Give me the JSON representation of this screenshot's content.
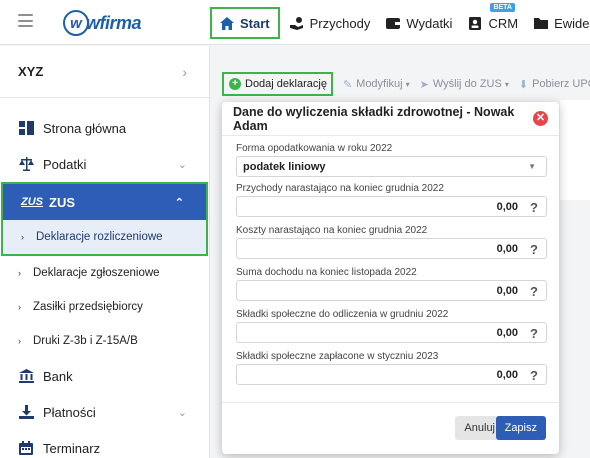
{
  "brand": {
    "logo_text": "wfirma"
  },
  "nav": {
    "items": [
      {
        "label": "Start",
        "icon": "home-icon"
      },
      {
        "label": "Przychody",
        "icon": "hand-coin-icon"
      },
      {
        "label": "Wydatki",
        "icon": "wallet-icon"
      },
      {
        "label": "CRM",
        "icon": "contact-card-icon",
        "badge": "BETA"
      },
      {
        "label": "Ewidencje",
        "icon": "folder-icon"
      }
    ]
  },
  "sidebar": {
    "company": "XYZ",
    "items": [
      {
        "label": "Strona główna",
        "icon": "dashboard-icon"
      },
      {
        "label": "Podatki",
        "icon": "scales-icon"
      },
      {
        "label": "ZUS",
        "icon": "zus-logo-icon",
        "logo_text": "ZUS"
      }
    ],
    "zus_sub": [
      {
        "label": "Deklaracje rozliczeniowe"
      },
      {
        "label": "Deklaracje zgłoszeniowe"
      },
      {
        "label": "Zasiłki przedsiębiorcy"
      },
      {
        "label": "Druki Z-3b i Z-15A/B"
      }
    ],
    "bottom_items": [
      {
        "label": "Bank",
        "icon": "bank-icon"
      },
      {
        "label": "Płatności",
        "icon": "download-icon"
      },
      {
        "label": "Terminarz",
        "icon": "calendar-icon"
      }
    ]
  },
  "toolbar": {
    "add": "Dodaj deklarację",
    "modify": "Modyfikuj",
    "send": "Wyślij do ZUS",
    "fetch": "Pobierz UPO"
  },
  "modal": {
    "title": "Dane do wyliczenia składki zdrowotnej - Nowak Adam",
    "tax_form_label": "Forma opodatkowania w roku 2022",
    "tax_form_value": "podatek liniowy",
    "fields": [
      {
        "label": "Przychody narastająco na koniec grudnia 2022",
        "value": "0,00"
      },
      {
        "label": "Koszty narastająco na koniec grudnia 2022",
        "value": "0,00"
      },
      {
        "label": "Suma dochodu na koniec listopada 2022",
        "value": "0,00"
      },
      {
        "label": "Składki społeczne do odliczenia w grudniu 2022",
        "value": "0,00"
      },
      {
        "label": "Składki społeczne zapłacone w styczniu 2023",
        "value": "0,00"
      }
    ],
    "help_symbol": "?",
    "cancel": "Anuluj",
    "save": "Zapisz"
  },
  "colors": {
    "accent": "#2d5db4",
    "highlight": "#3bb54a",
    "danger": "#e8454a"
  }
}
